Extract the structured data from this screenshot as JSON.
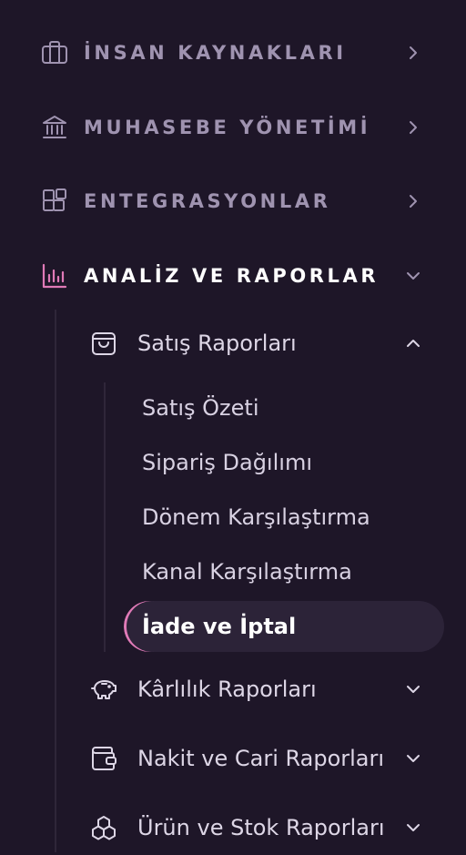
{
  "sections": [
    {
      "label": "İNSAN KAYNAKLARI",
      "icon": "briefcase-icon"
    },
    {
      "label": "MUHASEBE YÖNETİMİ",
      "icon": "bank-icon"
    },
    {
      "label": "ENTEGRASYONLAR",
      "icon": "integrations-icon"
    },
    {
      "label": "ANALİZ VE RAPORLAR",
      "icon": "bar-chart-icon",
      "active": true
    }
  ],
  "subsections": [
    {
      "label": "Satış Raporları",
      "icon": "shopping-bag-icon",
      "expanded": true
    },
    {
      "label": "Kârlılık Raporları",
      "icon": "piggy-bank-icon"
    },
    {
      "label": "Nakit ve Cari Raporları",
      "icon": "wallet-icon"
    },
    {
      "label": "Ürün ve Stok Raporları",
      "icon": "boxes-icon"
    }
  ],
  "sales_reports": {
    "items": [
      "Satış Özeti",
      "Sipariş Dağılımı",
      "Dönem Karşılaştırma",
      "Kanal Karşılaştırma"
    ],
    "active_item": "İade ve İptal"
  },
  "colors": {
    "background": "#1e1628",
    "accent": "#e07ab7",
    "muted_text": "#9f93b0",
    "active_bg": "#2c2338"
  }
}
